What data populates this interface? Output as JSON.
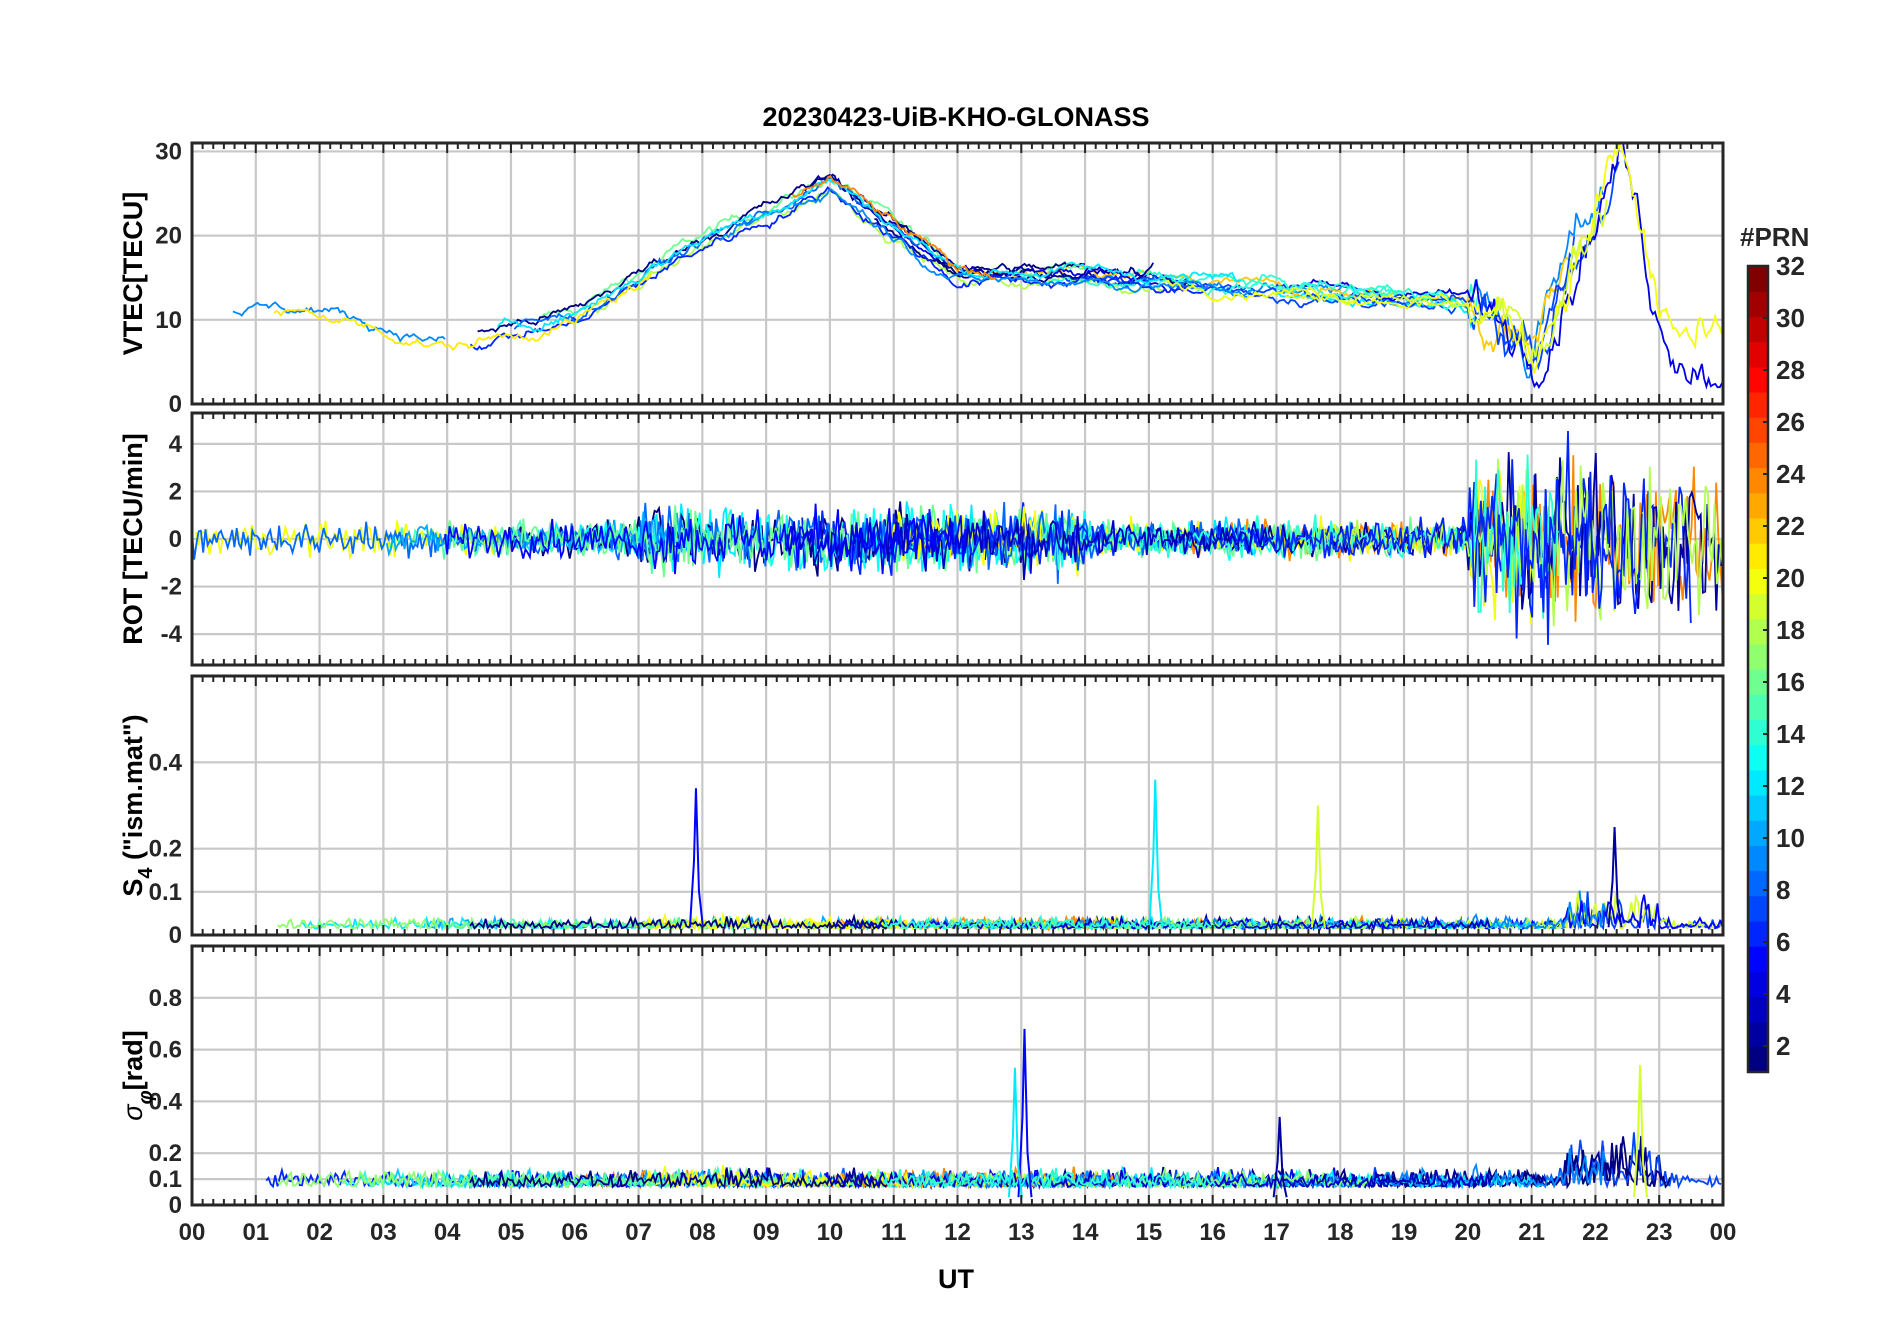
{
  "chart_data": {
    "type": "line",
    "title": "20230423-UiB-KHO-GLONASS",
    "xlabel": "UT",
    "x_tick_labels": [
      "00",
      "01",
      "02",
      "03",
      "04",
      "05",
      "06",
      "07",
      "08",
      "09",
      "10",
      "11",
      "12",
      "13",
      "14",
      "15",
      "16",
      "17",
      "18",
      "19",
      "20",
      "21",
      "22",
      "23",
      "00"
    ],
    "xlim_hours": [
      0,
      24
    ],
    "grid": true,
    "colorbar": {
      "label": "#PRN",
      "range": [
        1,
        32
      ],
      "ticks": [
        "2",
        "4",
        "6",
        "8",
        "10",
        "12",
        "14",
        "16",
        "18",
        "20",
        "22",
        "24",
        "26",
        "28",
        "30",
        "32"
      ],
      "colormap": "jet",
      "placement": "right"
    },
    "panels": [
      {
        "name": "vtec",
        "ylabel": "VTEC[TECU]",
        "ylim": [
          0,
          31
        ],
        "yticks": [
          "0",
          "10",
          "20",
          "30"
        ],
        "series_summary": [
          {
            "x": [
              0,
              2,
              4,
              6,
              8,
              9.5,
              10,
              12,
              14,
              16,
              18,
              20,
              21,
              22.4,
              23,
              24
            ],
            "y": [
              11,
              11,
              7,
              10,
              19,
              24,
              26,
              15,
              15,
              14,
              13,
              12,
              7,
              30,
              10,
              4
            ]
          }
        ]
      },
      {
        "name": "rot",
        "ylabel": "ROT [TECU/min]",
        "ylim": [
          -5.3,
          5.3
        ],
        "yticks": [
          "-4",
          "-2",
          "0",
          "2",
          "4"
        ]
      },
      {
        "name": "s4",
        "ylabel": "S4 (\"ism.mat\")",
        "ylabel_main": "S",
        "ylabel_sub": "4",
        "ylabel_rest": " (\"ism.mat\")",
        "ylim": [
          0,
          0.6
        ],
        "yticks": [
          "0",
          "0.1",
          "0.2",
          "0.4"
        ],
        "peaks": [
          {
            "x": 7.9,
            "y": 0.34
          },
          {
            "x": 15.1,
            "y": 0.36
          },
          {
            "x": 17.65,
            "y": 0.3
          },
          {
            "x": 22.3,
            "y": 0.25
          }
        ]
      },
      {
        "name": "sigma_phi",
        "ylabel": "σφ[rad]",
        "ylabel_main": "σ",
        "ylabel_sub": "φ",
        "ylabel_rest": "[rad]",
        "ylim": [
          0,
          1.0
        ],
        "yticks": [
          "0",
          "0.1",
          "0.2",
          "0.4",
          "0.6",
          "0.8"
        ],
        "peaks": [
          {
            "x": 13.05,
            "y": 0.68
          },
          {
            "x": 12.9,
            "y": 0.53
          },
          {
            "x": 22.7,
            "y": 0.54
          },
          {
            "x": 17.05,
            "y": 0.34
          }
        ]
      }
    ]
  }
}
